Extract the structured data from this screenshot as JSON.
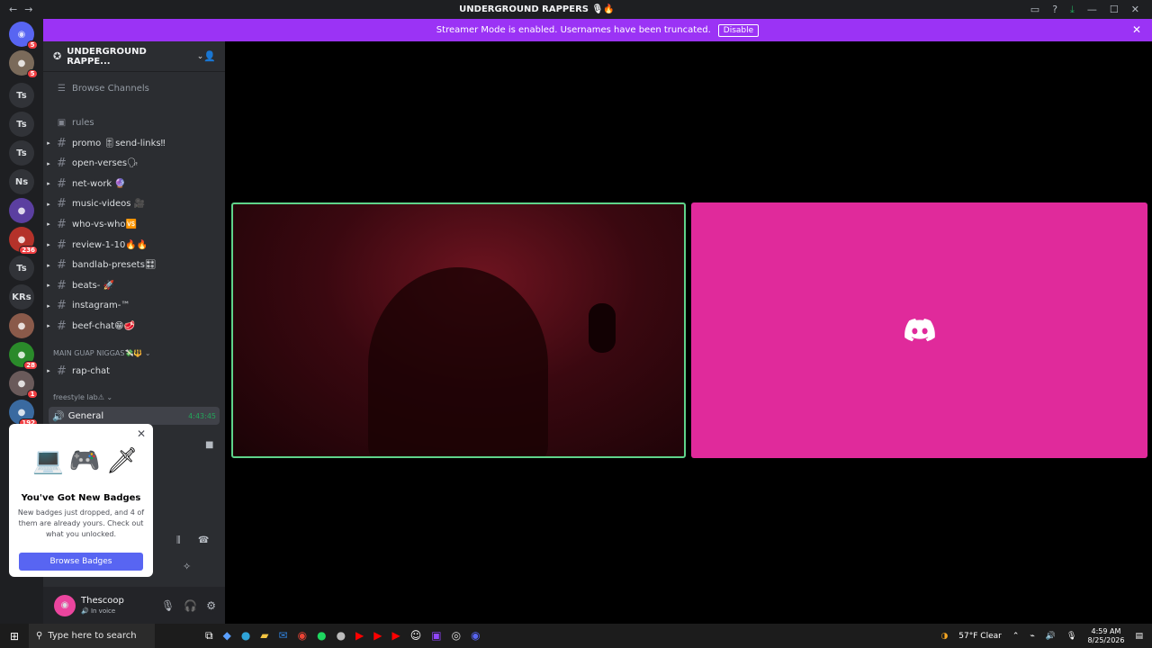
{
  "window": {
    "title": "UNDERGROUND RAPPERS 🎙🔥",
    "back": "←",
    "forward": "→"
  },
  "rail": {
    "servers": [
      {
        "label": "",
        "badge": "5",
        "color": "#5865f2",
        "glyph": "◉"
      },
      {
        "label": "",
        "badge": "5",
        "color": "#7a6a5a",
        "glyph": "●"
      },
      {
        "label": "Ts",
        "badge": ""
      },
      {
        "label": "Ts",
        "badge": ""
      },
      {
        "label": "Ts",
        "badge": ""
      },
      {
        "label": "Ns",
        "badge": ""
      },
      {
        "label": "",
        "badge": "",
        "color": "#5b3fa0",
        "glyph": "●"
      },
      {
        "label": "",
        "badge": "236",
        "color": "#b4322a",
        "glyph": "●"
      },
      {
        "label": "Ts",
        "badge": ""
      },
      {
        "label": "KRs",
        "badge": ""
      },
      {
        "label": "",
        "badge": "",
        "color": "#8a5a4a",
        "glyph": "●"
      },
      {
        "label": "",
        "badge": "28",
        "color": "#2a8a2a",
        "glyph": "●"
      },
      {
        "label": "",
        "badge": "1",
        "color": "#6a5a5a",
        "glyph": "●"
      },
      {
        "label": "",
        "badge": "192",
        "color": "#3a6aa0",
        "glyph": "●"
      }
    ]
  },
  "banner": {
    "text": "Streamer Mode is enabled. Usernames have been truncated.",
    "disable_label": "Disable",
    "close": "✕"
  },
  "server": {
    "name": "UNDERGROUND RAPPE...",
    "browse_channels": "Browse Channels",
    "rules": "rules",
    "channels": [
      "promo 🎚send-links‼",
      "open-verses🗣",
      "net-work 🔮",
      "music-videos 🎥",
      "who-vs-who🆚",
      "review-1-10🔥🔥",
      "bandlab-presets🎛",
      "beats- 🚀",
      "instagram-™",
      "beef-chat😁🥩"
    ],
    "category_1": "MAIN GUAP NIGGAS💸🔱 ⌄",
    "category_1_channels": [
      "rap-chat"
    ],
    "category_2": "freestyle lab⚠ ⌄",
    "voice_channel": "General",
    "voice_timer": "4:43:45"
  },
  "popup": {
    "heading": "You've Got New Badges",
    "body": "New badges just dropped, and 4 of them are already yours. Check out what you unlocked.",
    "button": "Browse Badges",
    "icons": [
      "💻",
      "🎮",
      "🗡"
    ]
  },
  "user": {
    "name": "Thescoop",
    "status": "In voice"
  },
  "taskbar": {
    "search_placeholder": "Type here to search",
    "weather": "57°F  Clear",
    "time": "4:59 AM",
    "date": "8/25/2026"
  }
}
